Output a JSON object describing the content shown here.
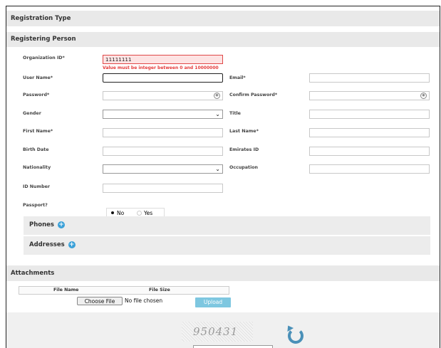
{
  "sections": {
    "registration_type": "Registration Type",
    "registering_person": "Registering Person",
    "attachments": "Attachments"
  },
  "form": {
    "org_id": {
      "label": "Organization ID*",
      "value": "11111111",
      "error": "Value must be integer between 0 and 10000000"
    },
    "user_name": {
      "label": "User Name*",
      "value": ""
    },
    "email": {
      "label": "Email*",
      "value": ""
    },
    "password": {
      "label": "Password*",
      "value": ""
    },
    "confirm_password": {
      "label": "Confirm Password*",
      "value": ""
    },
    "gender": {
      "label": "Gender",
      "value": ""
    },
    "title": {
      "label": "Title",
      "value": ""
    },
    "first_name": {
      "label": "First Name*",
      "value": ""
    },
    "last_name": {
      "label": "Last Name*",
      "value": ""
    },
    "birth_date": {
      "label": "Birth Date",
      "value": ""
    },
    "emirates_id": {
      "label": "Emirates ID",
      "value": ""
    },
    "nationality": {
      "label": "Nationality",
      "value": ""
    },
    "occupation": {
      "label": "Occupation",
      "value": ""
    },
    "id_number": {
      "label": "ID Number",
      "value": ""
    },
    "passport": {
      "label": "Passport?",
      "options": [
        "No",
        "Yes"
      ],
      "selected": "No"
    }
  },
  "panels": {
    "phones": "Phones",
    "addresses": "Addresses"
  },
  "attachments": {
    "columns": [
      "File Name",
      "File Size"
    ],
    "choose_file": "Choose File",
    "no_file": "No file chosen",
    "upload": "Upload"
  },
  "captcha": {
    "code": "950431"
  },
  "icons": {
    "eye": "eye-icon",
    "chevron": "chevron-down-icon",
    "plus": "plus-circle-icon",
    "refresh": "refresh-icon"
  },
  "colors": {
    "error": "#e53b3b",
    "accent": "#3aa0d8",
    "upload": "#7ec7e0"
  }
}
